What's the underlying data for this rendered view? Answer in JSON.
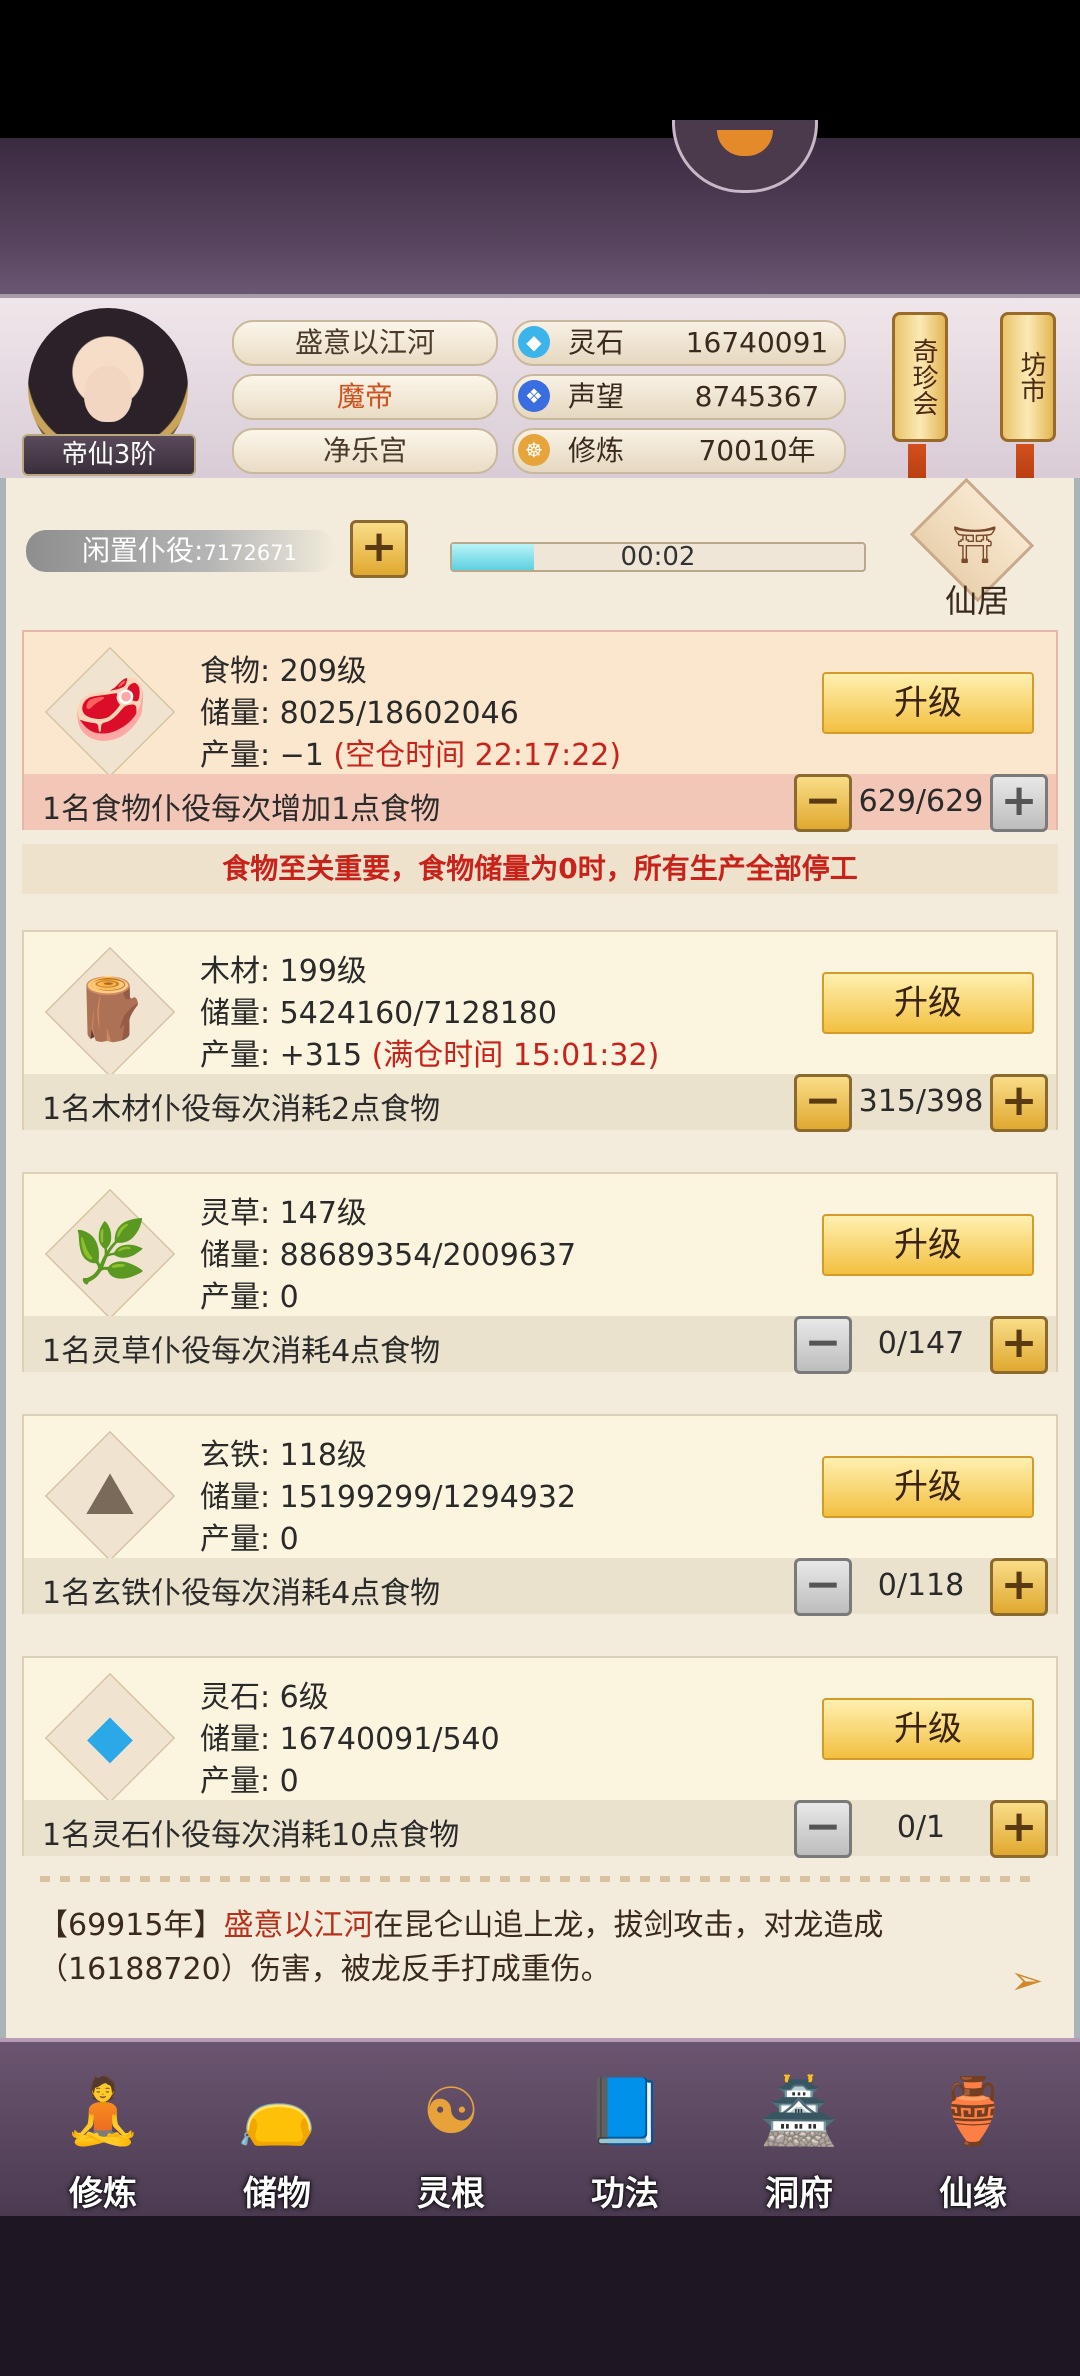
{
  "header": {
    "rank": "帝仙3阶",
    "name": "盛意以江河",
    "title": "魔帝",
    "sect": "净乐宫",
    "stats": [
      {
        "label": "灵石",
        "value": "16740091",
        "icon": "spirit-stone-icon"
      },
      {
        "label": "声望",
        "value": "8745367",
        "icon": "prestige-icon"
      },
      {
        "label": "修炼",
        "value": "70010年",
        "icon": "cultivation-icon"
      }
    ],
    "buttons": [
      {
        "label": "奇珍会"
      },
      {
        "label": "坊市"
      }
    ]
  },
  "workers": {
    "idle_label": "闲置仆役:",
    "idle_count": "7172671",
    "timer": "00:02",
    "timer_progress": 0.2,
    "residence_label": "仙居"
  },
  "resources": [
    {
      "name": "食物: 209级",
      "storage": "储量: 8025/18602046",
      "output_prefix": "产量: −1",
      "output_note": "(空仓时间 22:17:22)",
      "upgrade": "升级",
      "desc": "1名食物仆役每次增加1点食物",
      "count": "629/629",
      "icon": "meat-icon"
    },
    {
      "name": "木材: 199级",
      "storage": "储量: 5424160/7128180",
      "output_prefix": "产量: +315",
      "output_note": "(满仓时间 15:01:32)",
      "upgrade": "升级",
      "desc": "1名木材仆役每次消耗2点食物",
      "count": "315/398",
      "icon": "wood-icon"
    },
    {
      "name": "灵草: 147级",
      "storage": "储量: 88689354/2009637",
      "output_prefix": "产量: 0",
      "output_note": "",
      "upgrade": "升级",
      "desc": "1名灵草仆役每次消耗4点食物",
      "count": "0/147",
      "icon": "herb-icon"
    },
    {
      "name": "玄铁: 118级",
      "storage": "储量: 15199299/1294932",
      "output_prefix": "产量: 0",
      "output_note": "",
      "upgrade": "升级",
      "desc": "1名玄铁仆役每次消耗4点食物",
      "count": "0/118",
      "icon": "iron-ore-icon"
    },
    {
      "name": "灵石: 6级",
      "storage": "储量: 16740091/540",
      "output_prefix": "产量: 0",
      "output_note": "",
      "upgrade": "升级",
      "desc": "1名灵石仆役每次消耗10点食物",
      "count": "0/1",
      "icon": "spirit-stone-icon"
    }
  ],
  "warning": "食物至关重要，食物储量为0时，所有生产全部停工",
  "log": {
    "year": "【69915年】",
    "name": "盛意以江河",
    "text": "在昆仑山追上龙，拔剑攻击，对龙造成（16188720）伤害，被龙反手打成重伤。"
  },
  "nav": [
    {
      "label": "修炼",
      "icon": "cultivate-icon"
    },
    {
      "label": "储物",
      "icon": "storage-bag-icon"
    },
    {
      "label": "灵根",
      "icon": "spirit-root-icon"
    },
    {
      "label": "功法",
      "icon": "skill-book-icon"
    },
    {
      "label": "洞府",
      "icon": "cave-dwelling-icon"
    },
    {
      "label": "仙缘",
      "icon": "fortune-gourd-icon"
    }
  ],
  "colors": {
    "accent_gold": "#f2c040",
    "alert_red": "#c8221a",
    "panel_bg": "#f3ecdc"
  }
}
